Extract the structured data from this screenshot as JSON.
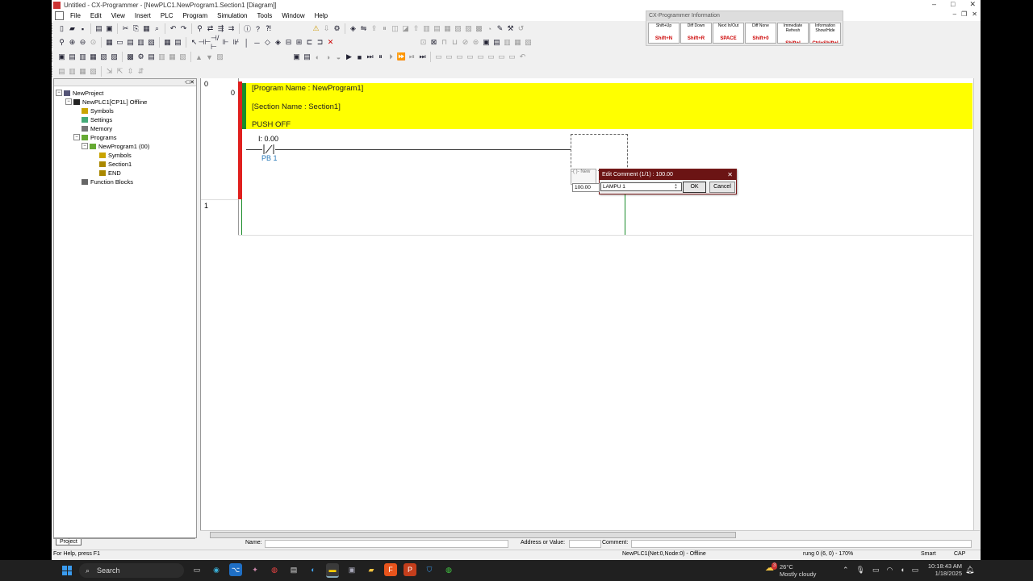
{
  "window": {
    "title": "Untitled - CX-Programmer - [NewPLC1.NewProgram1.Section1 [Diagram]]"
  },
  "menu": [
    "File",
    "Edit",
    "View",
    "Insert",
    "PLC",
    "Program",
    "Simulation",
    "Tools",
    "Window",
    "Help"
  ],
  "info_panel": {
    "title": "CX-Programmer Information",
    "keys": [
      {
        "label": "Shift+Up",
        "key": "Shift+N"
      },
      {
        "label": "Diff Down",
        "key": "Shift+R"
      },
      {
        "label": "Next In/Out",
        "key": "SPACE"
      },
      {
        "label": "Diff None",
        "key": "Shift+0"
      },
      {
        "label": "Immediate Refresh",
        "key": "Shift+I"
      },
      {
        "label": "Information Show/Hide",
        "key": "Ctrl+Shift+I"
      }
    ]
  },
  "tree": {
    "root": "NewProject",
    "plc": "NewPLC1[CP1L] Offline",
    "symbols": "Symbols",
    "settings": "Settings",
    "memory": "Memory",
    "programs": "Programs",
    "program1": "NewProgram1 (00)",
    "prog_symbols": "Symbols",
    "section1": "Section1",
    "end": "END",
    "function_blocks": "Function Blocks",
    "tab": "Project"
  },
  "ladder": {
    "rung0_number": "0",
    "rung0_step": "0",
    "rung1_number": "1",
    "comment_program": "[Program Name : NewProgram1]",
    "comment_section": "[Section Name : Section1]",
    "comment_rung": "PUSH OFF",
    "contact_address": "I: 0.00",
    "contact_comment": "PB 1"
  },
  "dialog": {
    "mini_title": "-( )- New",
    "title": "Edit Comment (1/1) : 100.00",
    "address": "100.00",
    "comment_value": "LAMPU 1",
    "ok": "OK",
    "cancel": "Cancel"
  },
  "properties": {
    "name_label": "Name:",
    "address_label": "Address or Value:",
    "comment_label": "Comment:"
  },
  "status": {
    "help": "For Help, press F1",
    "net": "NewPLC1(Net:0,Node:0) - Offline",
    "rung": "rung 0 (6, 0) - 170%",
    "mode": "Smart",
    "caps": "CAP"
  },
  "taskbar": {
    "search": "Search",
    "weather_temp": "26°C",
    "weather_desc": "Mostly cloudy",
    "weather_badge": "3",
    "time": "10:18:43 AM",
    "date": "1/18/2025"
  }
}
